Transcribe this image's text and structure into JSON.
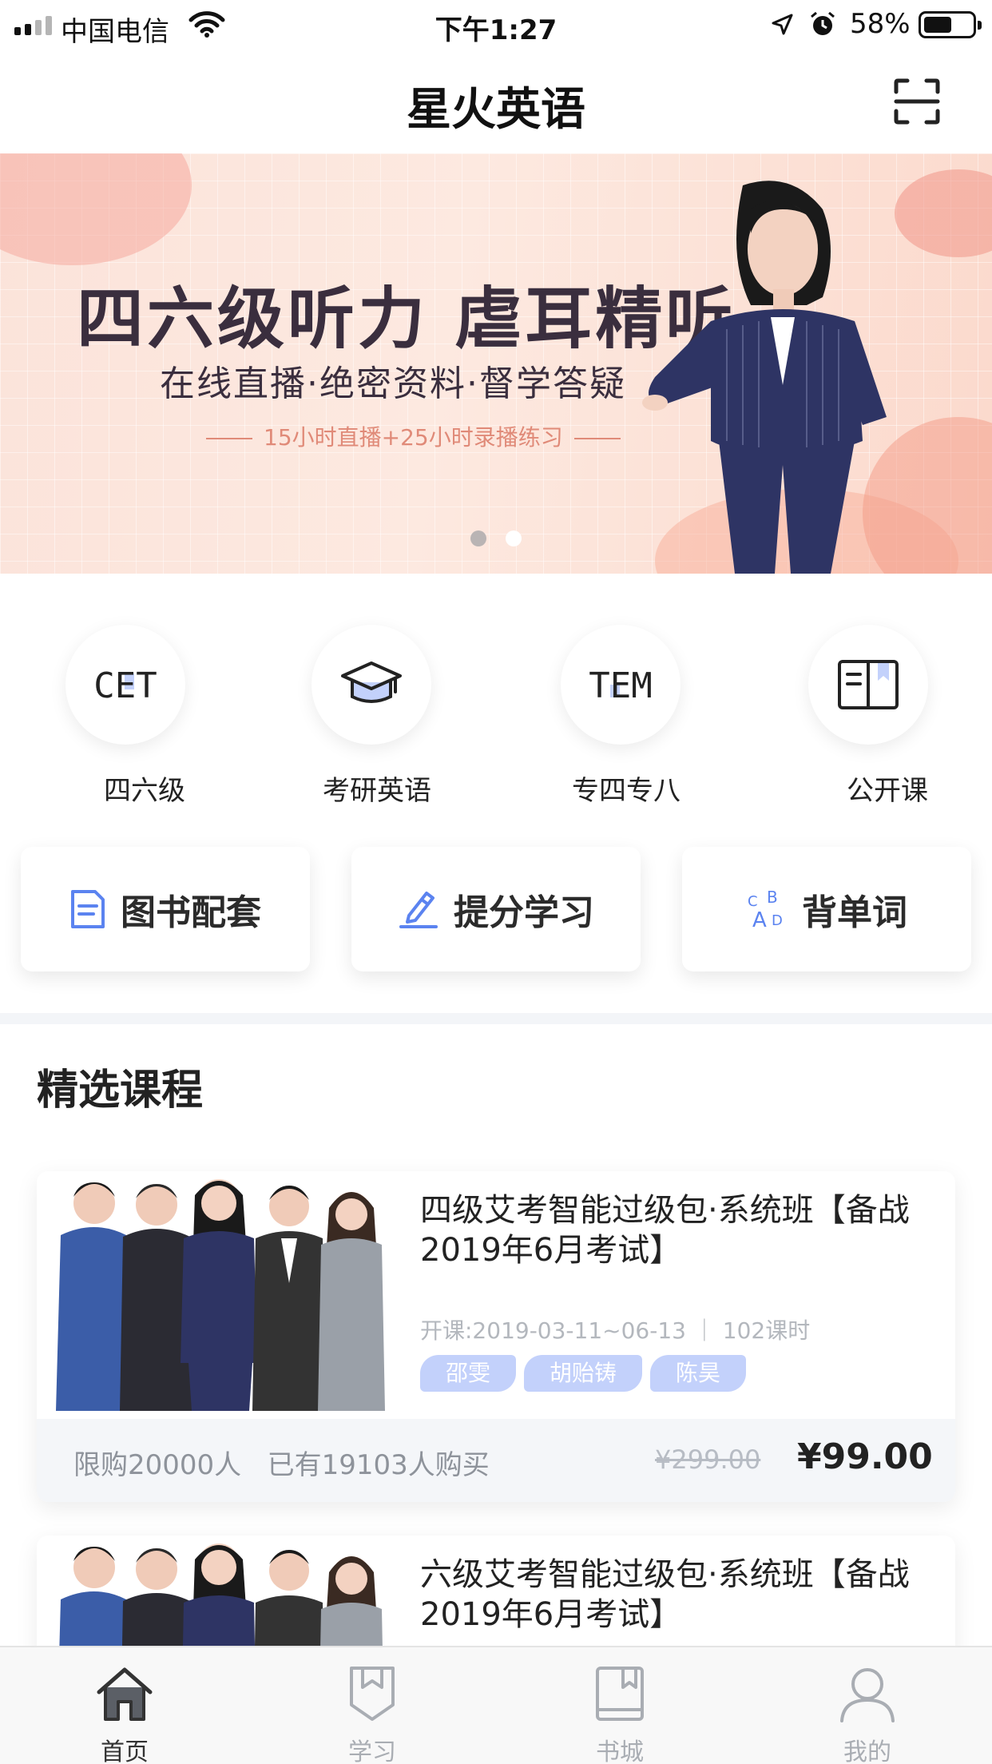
{
  "status_bar": {
    "carrier": "中国电信",
    "time": "下午1:27",
    "battery": "58%",
    "battery_level": 0.58,
    "icons": [
      "signal-icon",
      "wifi-icon",
      "location-arrow-icon",
      "alarm-icon",
      "battery-icon"
    ]
  },
  "nav": {
    "title": "星火英语",
    "scan_icon": "scan-icon"
  },
  "banner": {
    "headline": "四六级听力 虐耳精听",
    "subtitle": "在线直播·绝密资料·督学答疑",
    "tagline": "15小时直播+25小时录播练习",
    "slide_count": 2,
    "active_slide": 1
  },
  "categories": [
    {
      "label": "四六级",
      "icon_text": "CET",
      "icon": "cet-icon"
    },
    {
      "label": "考研英语",
      "icon": "graduation-cap-icon"
    },
    {
      "label": "专四专八",
      "icon_text": "TEM",
      "icon": "tem-icon"
    },
    {
      "label": "公开课",
      "icon": "open-book-icon"
    }
  ],
  "quick_actions": [
    {
      "label": "图书配套",
      "icon": "document-icon"
    },
    {
      "label": "提分学习",
      "icon": "pen-icon"
    },
    {
      "label": "背单词",
      "icon": "abcd-letters-icon",
      "icon_text": "CBAD"
    }
  ],
  "section": {
    "title": "精选课程"
  },
  "courses": [
    {
      "title": "四级艾考智能过级包·系统班【备战2019年6月考试】",
      "meta": "开课:2019-03-11~06-13 ｜ 102课时",
      "teachers": [
        "邵雯",
        "胡贻铸",
        "陈昊"
      ],
      "limit": "限购20000人",
      "sold": "已有19103人购买",
      "original_price": "¥299.00",
      "price": "¥99.00"
    },
    {
      "title": "六级艾考智能过级包·系统班【备战2019年6月考试】"
    }
  ],
  "tabs": [
    {
      "label": "首页",
      "icon": "home-icon",
      "active": true
    },
    {
      "label": "学习",
      "icon": "bookmark-shield-icon",
      "active": false
    },
    {
      "label": "书城",
      "icon": "book-icon",
      "active": false
    },
    {
      "label": "我的",
      "icon": "user-icon",
      "active": false
    }
  ],
  "colors": {
    "accent_blue": "#5b83f0",
    "tag_bg": "#c3d1fb",
    "tab_active": "#333333",
    "tab_inactive": "#a9adb3",
    "banner_pink": "#fbe3da"
  }
}
